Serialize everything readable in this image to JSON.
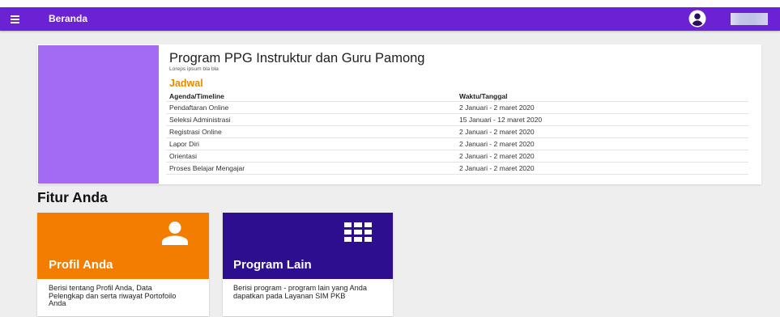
{
  "app_bar": {
    "title": "Beranda",
    "menu_icon": "menu-icon",
    "avatar_icon": "account-circle-icon"
  },
  "program": {
    "title": "Program PPG Instruktur dan Guru Pamong",
    "subtitle": "Loreps ipsum bla bla",
    "schedule": {
      "heading": "Jadwal",
      "columns": [
        "Agenda/Timeline",
        "Waktu/Tanggal"
      ],
      "rows": [
        {
          "agenda": "Pendaftaran Online",
          "date": "2 Januari - 2 maret 2020"
        },
        {
          "agenda": "Seleksi Administrasi",
          "date": "15 Januari - 12 maret 2020"
        },
        {
          "agenda": "Registrasi Online",
          "date": "2 Januari - 2 maret 2020"
        },
        {
          "agenda": "Lapor Diri",
          "date": "2 Januari - 2 maret 2020"
        },
        {
          "agenda": "Orientasi",
          "date": "2 Januari - 2 maret 2020"
        },
        {
          "agenda": "Proses Belajar Mengajar",
          "date": "2 Januari - 2 maret 2020"
        }
      ]
    }
  },
  "features": {
    "heading": "Fitur Anda",
    "cards": [
      {
        "title": "Profil Anda",
        "description": "Berisi tentang Profil Anda, Data Pelengkap dan serta riwayat Portofoilo Anda",
        "icon": "person-icon"
      },
      {
        "title": "Program Lain",
        "description": "Berisi program - program lain yang Anda dapatkan pada Layanan SIM PKB",
        "icon": "apps-grid-icon"
      }
    ]
  },
  "colors": {
    "app_bar": "#6a22d4",
    "banner": "#a26bf2",
    "schedule_heading": "#e88a00",
    "profile_card": "#f27d00",
    "program_card": "#2d0e8e",
    "page_background": "#eeeeee"
  }
}
